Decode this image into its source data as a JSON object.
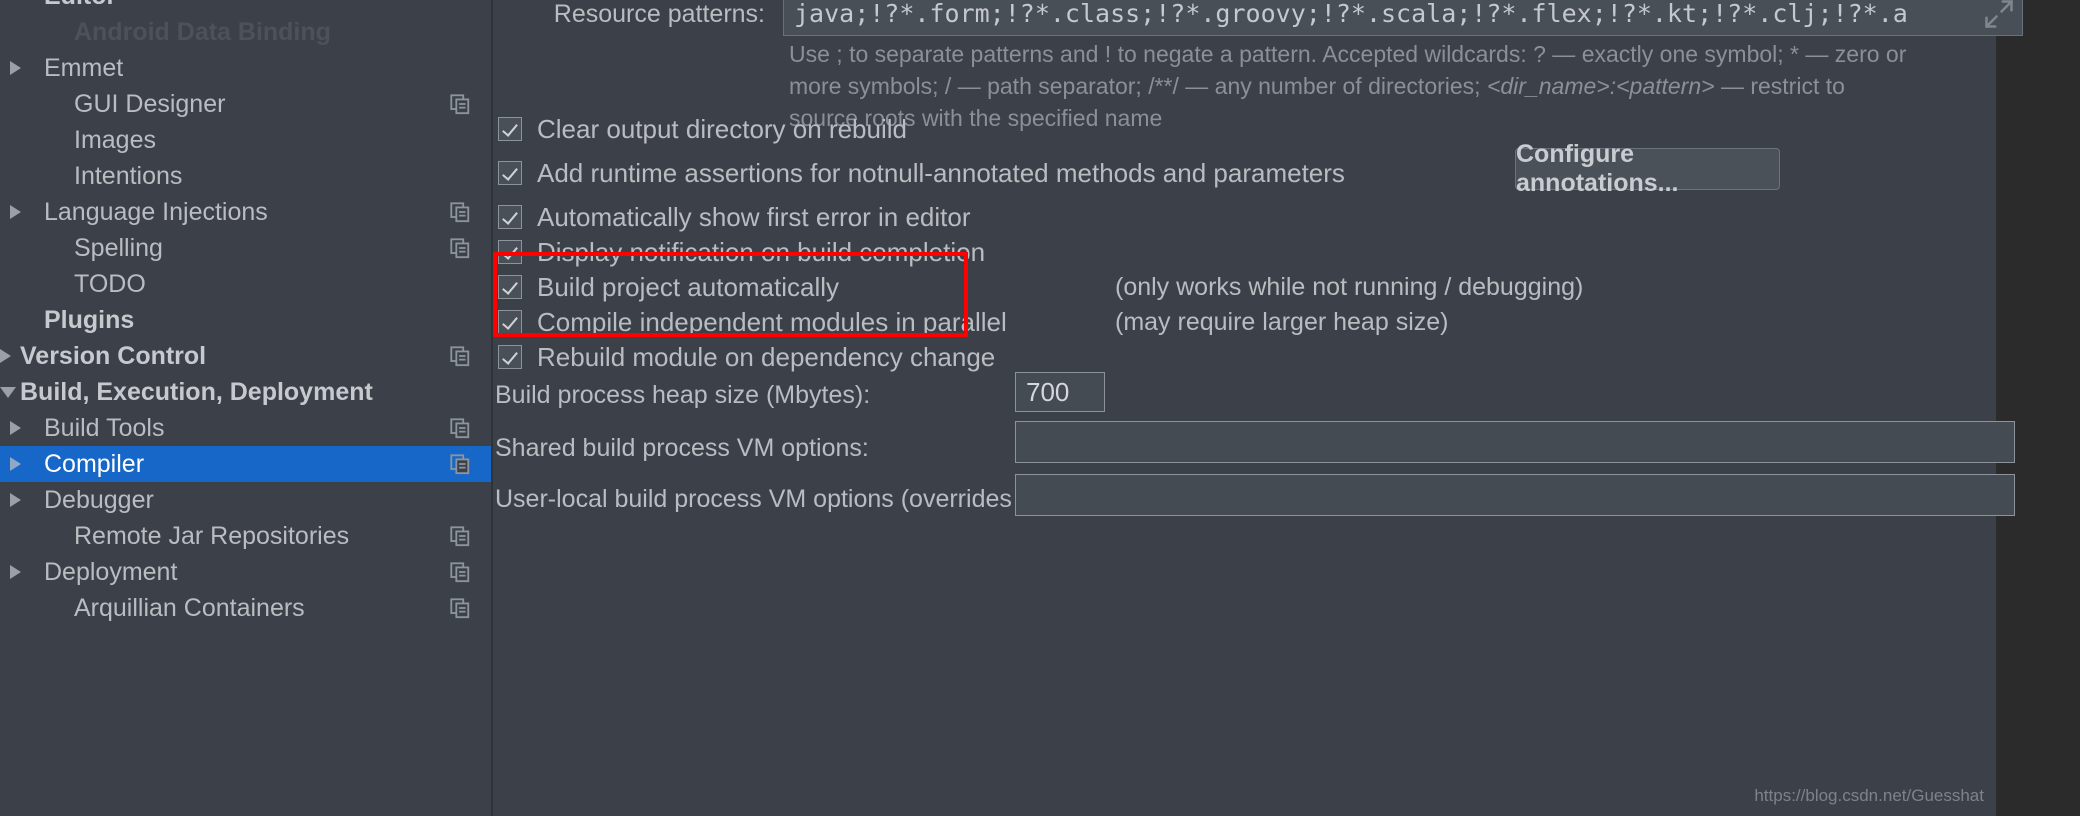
{
  "sidebar": {
    "items": [
      {
        "label": "Editor",
        "indent": 36,
        "arrow": "none",
        "bold": true,
        "copy": false,
        "selected": false,
        "ghost": false
      },
      {
        "label": "Android Data Binding",
        "indent": 66,
        "arrow": "none",
        "bold": true,
        "copy": false,
        "selected": false,
        "ghost": true
      },
      {
        "label": "Emmet",
        "indent": 36,
        "arrow": "right",
        "bold": false,
        "copy": false,
        "selected": false,
        "ghost": false
      },
      {
        "label": "GUI Designer",
        "indent": 66,
        "arrow": "none",
        "bold": false,
        "copy": true,
        "selected": false,
        "ghost": false
      },
      {
        "label": "Images",
        "indent": 66,
        "arrow": "none",
        "bold": false,
        "copy": false,
        "selected": false,
        "ghost": false
      },
      {
        "label": "Intentions",
        "indent": 66,
        "arrow": "none",
        "bold": false,
        "copy": false,
        "selected": false,
        "ghost": false
      },
      {
        "label": "Language Injections",
        "indent": 36,
        "arrow": "right",
        "bold": false,
        "copy": true,
        "selected": false,
        "ghost": false
      },
      {
        "label": "Spelling",
        "indent": 66,
        "arrow": "none",
        "bold": false,
        "copy": true,
        "selected": false,
        "ghost": false
      },
      {
        "label": "TODO",
        "indent": 66,
        "arrow": "none",
        "bold": false,
        "copy": false,
        "selected": false,
        "ghost": false
      },
      {
        "label": "Plugins",
        "indent": 36,
        "arrow": "none",
        "bold": true,
        "copy": false,
        "selected": false,
        "ghost": false
      },
      {
        "label": "Version Control",
        "indent": 12,
        "arrow": "right",
        "bold": true,
        "copy": true,
        "selected": false,
        "ghost": false
      },
      {
        "label": "Build, Execution, Deployment",
        "indent": 12,
        "arrow": "down",
        "bold": true,
        "copy": false,
        "selected": false,
        "ghost": false
      },
      {
        "label": "Build Tools",
        "indent": 36,
        "arrow": "right",
        "bold": false,
        "copy": true,
        "selected": false,
        "ghost": false
      },
      {
        "label": "Compiler",
        "indent": 36,
        "arrow": "right",
        "bold": false,
        "copy": true,
        "selected": true,
        "ghost": false
      },
      {
        "label": "Debugger",
        "indent": 36,
        "arrow": "right",
        "bold": false,
        "copy": false,
        "selected": false,
        "ghost": false
      },
      {
        "label": "Remote Jar Repositories",
        "indent": 66,
        "arrow": "none",
        "bold": false,
        "copy": true,
        "selected": false,
        "ghost": false
      },
      {
        "label": "Deployment",
        "indent": 36,
        "arrow": "right",
        "bold": false,
        "copy": true,
        "selected": false,
        "ghost": false
      },
      {
        "label": "Arquillian Containers",
        "indent": 66,
        "arrow": "none",
        "bold": false,
        "copy": true,
        "selected": false,
        "ghost": false
      }
    ]
  },
  "main": {
    "resource_patterns": {
      "label": "Resource patterns:",
      "value": "java;!?*.form;!?*.class;!?*.groovy;!?*.scala;!?*.flex;!?*.kt;!?*.clj;!?*.a",
      "hint_line1": "Use ; to separate patterns and ! to negate a pattern. Accepted wildcards: ? — exactly one symbol; * — zero or",
      "hint_line2_a": "more symbols; / — path separator; /**/ — any number of directories; ",
      "hint_line2_b": "<dir_name>:<pattern>",
      "hint_line2_c": " — restrict to",
      "hint_line3": "source roots with the specified name"
    },
    "checkboxes": [
      {
        "label": "Clear output directory on rebuild",
        "checked": true,
        "hint": ""
      },
      {
        "label": "Add runtime assertions for notnull-annotated methods and parameters",
        "checked": true,
        "hint": ""
      },
      {
        "label": "Automatically show first error in editor",
        "checked": true,
        "hint": ""
      },
      {
        "label": "Display notification on build completion",
        "checked": true,
        "hint": ""
      },
      {
        "label": "Build project automatically",
        "checked": true,
        "hint": "(only works while not running / debugging)"
      },
      {
        "label": "Compile independent modules in parallel",
        "checked": true,
        "hint": "(may require larger heap size)"
      },
      {
        "label": "Rebuild module on dependency change",
        "checked": true,
        "hint": ""
      }
    ],
    "configure_annotations_button": "Configure annotations...",
    "fields": [
      {
        "label": "Build process heap size (Mbytes):",
        "value": "700"
      },
      {
        "label": "Shared build process VM options:",
        "value": ""
      },
      {
        "label": "User-local build process VM options (overrides Shared options):",
        "value": ""
      }
    ],
    "highlight_color": "#ff0000",
    "accent_color": "#1767c8"
  },
  "watermark": "https://blog.csdn.net/Guesshat"
}
